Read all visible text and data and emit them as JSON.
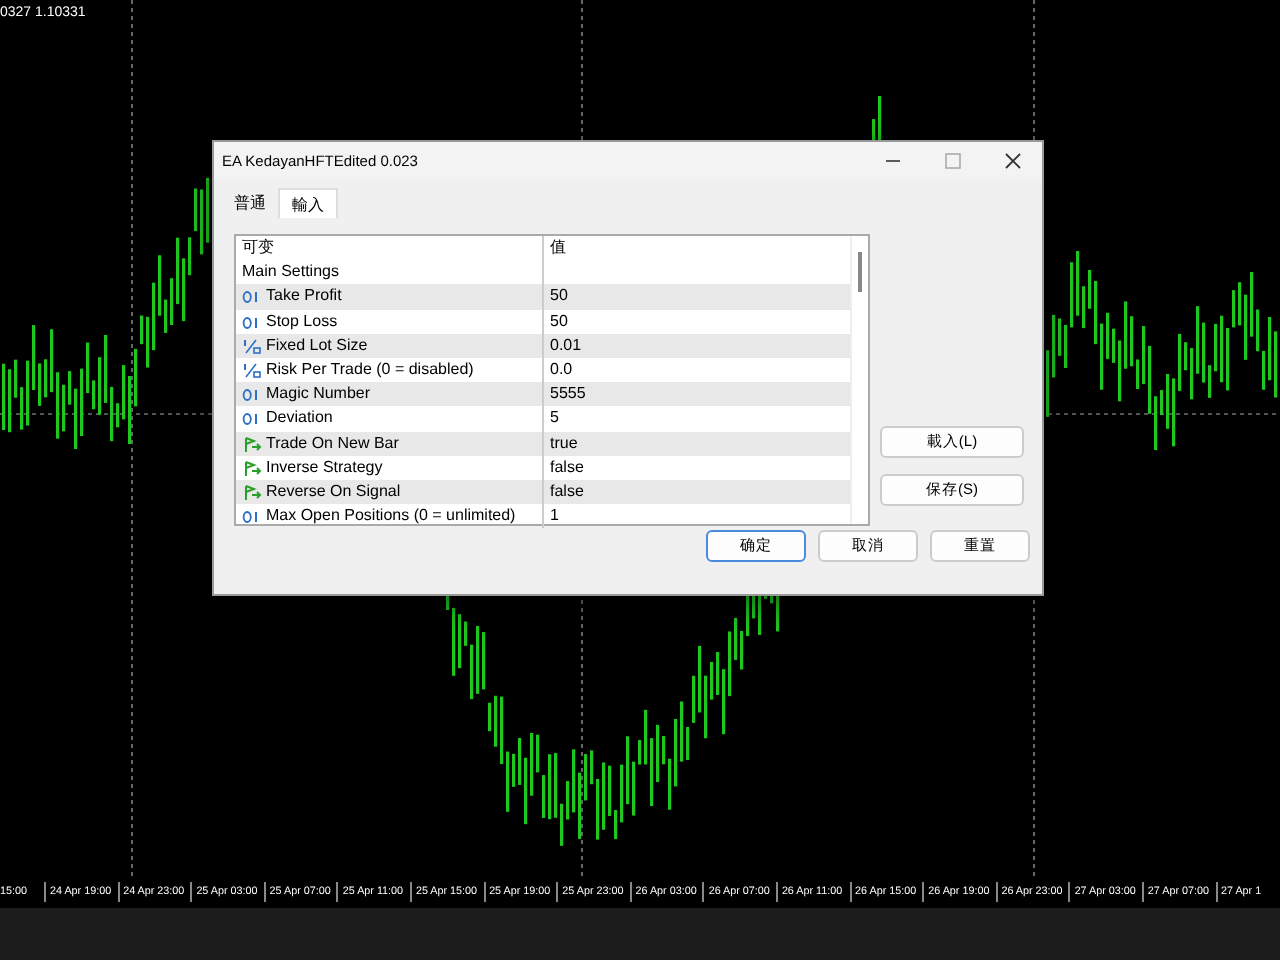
{
  "chart": {
    "price_label": "0327 1.10331",
    "time_labels": [
      "15:00",
      "24 Apr 19:00",
      "24 Apr 23:00",
      "25 Apr 03:00",
      "25 Apr 07:00",
      "25 Apr 11:00",
      "25 Apr 15:00",
      "25 Apr 19:00",
      "25 Apr 23:00",
      "26 Apr 03:00",
      "26 Apr 07:00",
      "26 Apr 11:00",
      "26 Apr 15:00",
      "26 Apr 19:00",
      "26 Apr 23:00",
      "27 Apr 03:00",
      "27 Apr 07:00",
      "27 Apr 1"
    ]
  },
  "dialog": {
    "title": "EA KedayanHFTEdited 0.023",
    "tabs": [
      {
        "label": "普通",
        "selected": false
      },
      {
        "label": "輸入",
        "selected": true
      }
    ],
    "table": {
      "columns": [
        "可变",
        "值"
      ],
      "rows": [
        {
          "kind": "group",
          "name": "Main Settings"
        },
        {
          "kind": "int",
          "name": "Take Profit",
          "value": "50"
        },
        {
          "kind": "int",
          "name": "Stop Loss",
          "value": "50"
        },
        {
          "kind": "double",
          "name": "Fixed Lot Size",
          "value": "0.01"
        },
        {
          "kind": "double",
          "name": "Risk Per Trade (0 = disabled)",
          "value": "0.0"
        },
        {
          "kind": "int",
          "name": "Magic Number",
          "value": "5555"
        },
        {
          "kind": "int",
          "name": "Deviation",
          "value": "5"
        },
        {
          "kind": "bool",
          "name": "Trade On New Bar",
          "value": "true"
        },
        {
          "kind": "bool",
          "name": "Inverse Strategy",
          "value": "false"
        },
        {
          "kind": "bool",
          "name": "Reverse On Signal",
          "value": "false"
        },
        {
          "kind": "int",
          "name": "Max Open Positions (0 = unlimited)",
          "value": "1"
        }
      ]
    },
    "side_buttons": [
      "載入(L)",
      "保存(S)"
    ],
    "buttons": [
      {
        "label": "确定",
        "default": true
      },
      {
        "label": "取消",
        "default": false
      },
      {
        "label": "重置",
        "default": false
      }
    ]
  }
}
